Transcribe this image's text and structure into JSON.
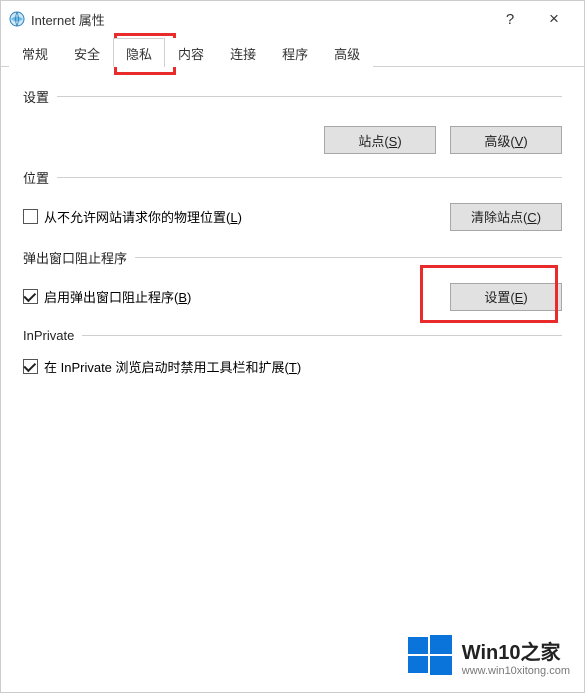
{
  "window": {
    "title": "Internet 属性",
    "help_symbol": "?",
    "close_symbol": "×"
  },
  "tabs": {
    "items": [
      {
        "label": "常规"
      },
      {
        "label": "安全"
      },
      {
        "label": "隐私"
      },
      {
        "label": "内容"
      },
      {
        "label": "连接"
      },
      {
        "label": "程序"
      },
      {
        "label": "高级"
      }
    ],
    "active_index": 2
  },
  "sections": {
    "settings": {
      "label": "设置",
      "buttons": {
        "sites": {
          "text": "站点(",
          "accel": "S",
          "suffix": ")"
        },
        "advanced": {
          "text": "高级(",
          "accel": "V",
          "suffix": ")"
        }
      }
    },
    "location": {
      "label": "位置",
      "checkbox": {
        "checked": false,
        "text": "从不允许网站请求你的物理位置(",
        "accel": "L",
        "suffix": ")"
      },
      "clear_btn": {
        "text": "清除站点(",
        "accel": "C",
        "suffix": ")"
      }
    },
    "popup": {
      "label": "弹出窗口阻止程序",
      "checkbox": {
        "checked": true,
        "text": "启用弹出窗口阻止程序(",
        "accel": "B",
        "suffix": ")"
      },
      "settings_btn": {
        "text": "设置(",
        "accel": "E",
        "suffix": ")"
      }
    },
    "inprivate": {
      "label": "InPrivate",
      "checkbox": {
        "checked": true,
        "text": "在 InPrivate 浏览启动时禁用工具栏和扩展(",
        "accel": "T",
        "suffix": ")"
      }
    }
  },
  "watermark": {
    "title": "Win10之家",
    "url": "www.win10xitong.com"
  }
}
